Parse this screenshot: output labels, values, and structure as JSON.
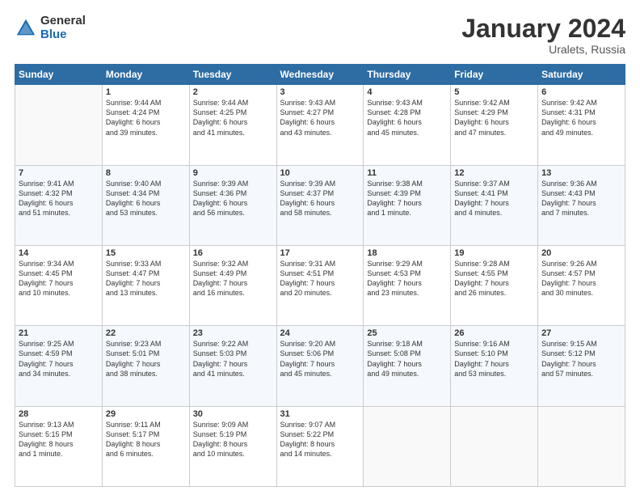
{
  "logo": {
    "general": "General",
    "blue": "Blue"
  },
  "header": {
    "title": "January 2024",
    "location": "Uralets, Russia"
  },
  "columns": [
    "Sunday",
    "Monday",
    "Tuesday",
    "Wednesday",
    "Thursday",
    "Friday",
    "Saturday"
  ],
  "weeks": [
    [
      {
        "day": "",
        "info": ""
      },
      {
        "day": "1",
        "info": "Sunrise: 9:44 AM\nSunset: 4:24 PM\nDaylight: 6 hours\nand 39 minutes."
      },
      {
        "day": "2",
        "info": "Sunrise: 9:44 AM\nSunset: 4:25 PM\nDaylight: 6 hours\nand 41 minutes."
      },
      {
        "day": "3",
        "info": "Sunrise: 9:43 AM\nSunset: 4:27 PM\nDaylight: 6 hours\nand 43 minutes."
      },
      {
        "day": "4",
        "info": "Sunrise: 9:43 AM\nSunset: 4:28 PM\nDaylight: 6 hours\nand 45 minutes."
      },
      {
        "day": "5",
        "info": "Sunrise: 9:42 AM\nSunset: 4:29 PM\nDaylight: 6 hours\nand 47 minutes."
      },
      {
        "day": "6",
        "info": "Sunrise: 9:42 AM\nSunset: 4:31 PM\nDaylight: 6 hours\nand 49 minutes."
      }
    ],
    [
      {
        "day": "7",
        "info": "Sunrise: 9:41 AM\nSunset: 4:32 PM\nDaylight: 6 hours\nand 51 minutes."
      },
      {
        "day": "8",
        "info": "Sunrise: 9:40 AM\nSunset: 4:34 PM\nDaylight: 6 hours\nand 53 minutes."
      },
      {
        "day": "9",
        "info": "Sunrise: 9:39 AM\nSunset: 4:36 PM\nDaylight: 6 hours\nand 56 minutes."
      },
      {
        "day": "10",
        "info": "Sunrise: 9:39 AM\nSunset: 4:37 PM\nDaylight: 6 hours\nand 58 minutes."
      },
      {
        "day": "11",
        "info": "Sunrise: 9:38 AM\nSunset: 4:39 PM\nDaylight: 7 hours\nand 1 minute."
      },
      {
        "day": "12",
        "info": "Sunrise: 9:37 AM\nSunset: 4:41 PM\nDaylight: 7 hours\nand 4 minutes."
      },
      {
        "day": "13",
        "info": "Sunrise: 9:36 AM\nSunset: 4:43 PM\nDaylight: 7 hours\nand 7 minutes."
      }
    ],
    [
      {
        "day": "14",
        "info": "Sunrise: 9:34 AM\nSunset: 4:45 PM\nDaylight: 7 hours\nand 10 minutes."
      },
      {
        "day": "15",
        "info": "Sunrise: 9:33 AM\nSunset: 4:47 PM\nDaylight: 7 hours\nand 13 minutes."
      },
      {
        "day": "16",
        "info": "Sunrise: 9:32 AM\nSunset: 4:49 PM\nDaylight: 7 hours\nand 16 minutes."
      },
      {
        "day": "17",
        "info": "Sunrise: 9:31 AM\nSunset: 4:51 PM\nDaylight: 7 hours\nand 20 minutes."
      },
      {
        "day": "18",
        "info": "Sunrise: 9:29 AM\nSunset: 4:53 PM\nDaylight: 7 hours\nand 23 minutes."
      },
      {
        "day": "19",
        "info": "Sunrise: 9:28 AM\nSunset: 4:55 PM\nDaylight: 7 hours\nand 26 minutes."
      },
      {
        "day": "20",
        "info": "Sunrise: 9:26 AM\nSunset: 4:57 PM\nDaylight: 7 hours\nand 30 minutes."
      }
    ],
    [
      {
        "day": "21",
        "info": "Sunrise: 9:25 AM\nSunset: 4:59 PM\nDaylight: 7 hours\nand 34 minutes."
      },
      {
        "day": "22",
        "info": "Sunrise: 9:23 AM\nSunset: 5:01 PM\nDaylight: 7 hours\nand 38 minutes."
      },
      {
        "day": "23",
        "info": "Sunrise: 9:22 AM\nSunset: 5:03 PM\nDaylight: 7 hours\nand 41 minutes."
      },
      {
        "day": "24",
        "info": "Sunrise: 9:20 AM\nSunset: 5:06 PM\nDaylight: 7 hours\nand 45 minutes."
      },
      {
        "day": "25",
        "info": "Sunrise: 9:18 AM\nSunset: 5:08 PM\nDaylight: 7 hours\nand 49 minutes."
      },
      {
        "day": "26",
        "info": "Sunrise: 9:16 AM\nSunset: 5:10 PM\nDaylight: 7 hours\nand 53 minutes."
      },
      {
        "day": "27",
        "info": "Sunrise: 9:15 AM\nSunset: 5:12 PM\nDaylight: 7 hours\nand 57 minutes."
      }
    ],
    [
      {
        "day": "28",
        "info": "Sunrise: 9:13 AM\nSunset: 5:15 PM\nDaylight: 8 hours\nand 1 minute."
      },
      {
        "day": "29",
        "info": "Sunrise: 9:11 AM\nSunset: 5:17 PM\nDaylight: 8 hours\nand 6 minutes."
      },
      {
        "day": "30",
        "info": "Sunrise: 9:09 AM\nSunset: 5:19 PM\nDaylight: 8 hours\nand 10 minutes."
      },
      {
        "day": "31",
        "info": "Sunrise: 9:07 AM\nSunset: 5:22 PM\nDaylight: 8 hours\nand 14 minutes."
      },
      {
        "day": "",
        "info": ""
      },
      {
        "day": "",
        "info": ""
      },
      {
        "day": "",
        "info": ""
      }
    ]
  ]
}
